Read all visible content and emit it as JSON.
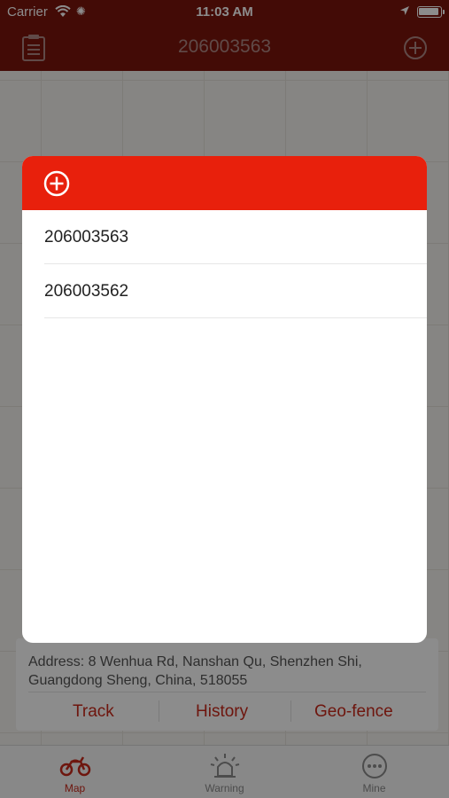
{
  "status": {
    "carrier": "Carrier",
    "time": "11:03 AM"
  },
  "nav": {
    "title": "206003563",
    "left_icon": "list-icon",
    "right_icon": "add-circle-icon"
  },
  "info": {
    "address": "Address: 8 Wenhua Rd, Nanshan Qu, Shenzhen Shi, Guangdong Sheng, China, 518055",
    "actions": {
      "track": "Track",
      "history": "History",
      "geofence": "Geo-fence"
    }
  },
  "tabs": [
    {
      "label": "Map",
      "icon": "motorcycle-icon",
      "active": true
    },
    {
      "label": "Warning",
      "icon": "alarm-light-icon",
      "active": false
    },
    {
      "label": "Mine",
      "icon": "more-icon",
      "active": false
    }
  ],
  "popup": {
    "header_icon": "add-circle-icon",
    "devices": [
      "206003563",
      "206003562"
    ]
  },
  "colors": {
    "nav": "#7a150c",
    "accent": "#e8200c",
    "action_text": "#c8281a"
  }
}
